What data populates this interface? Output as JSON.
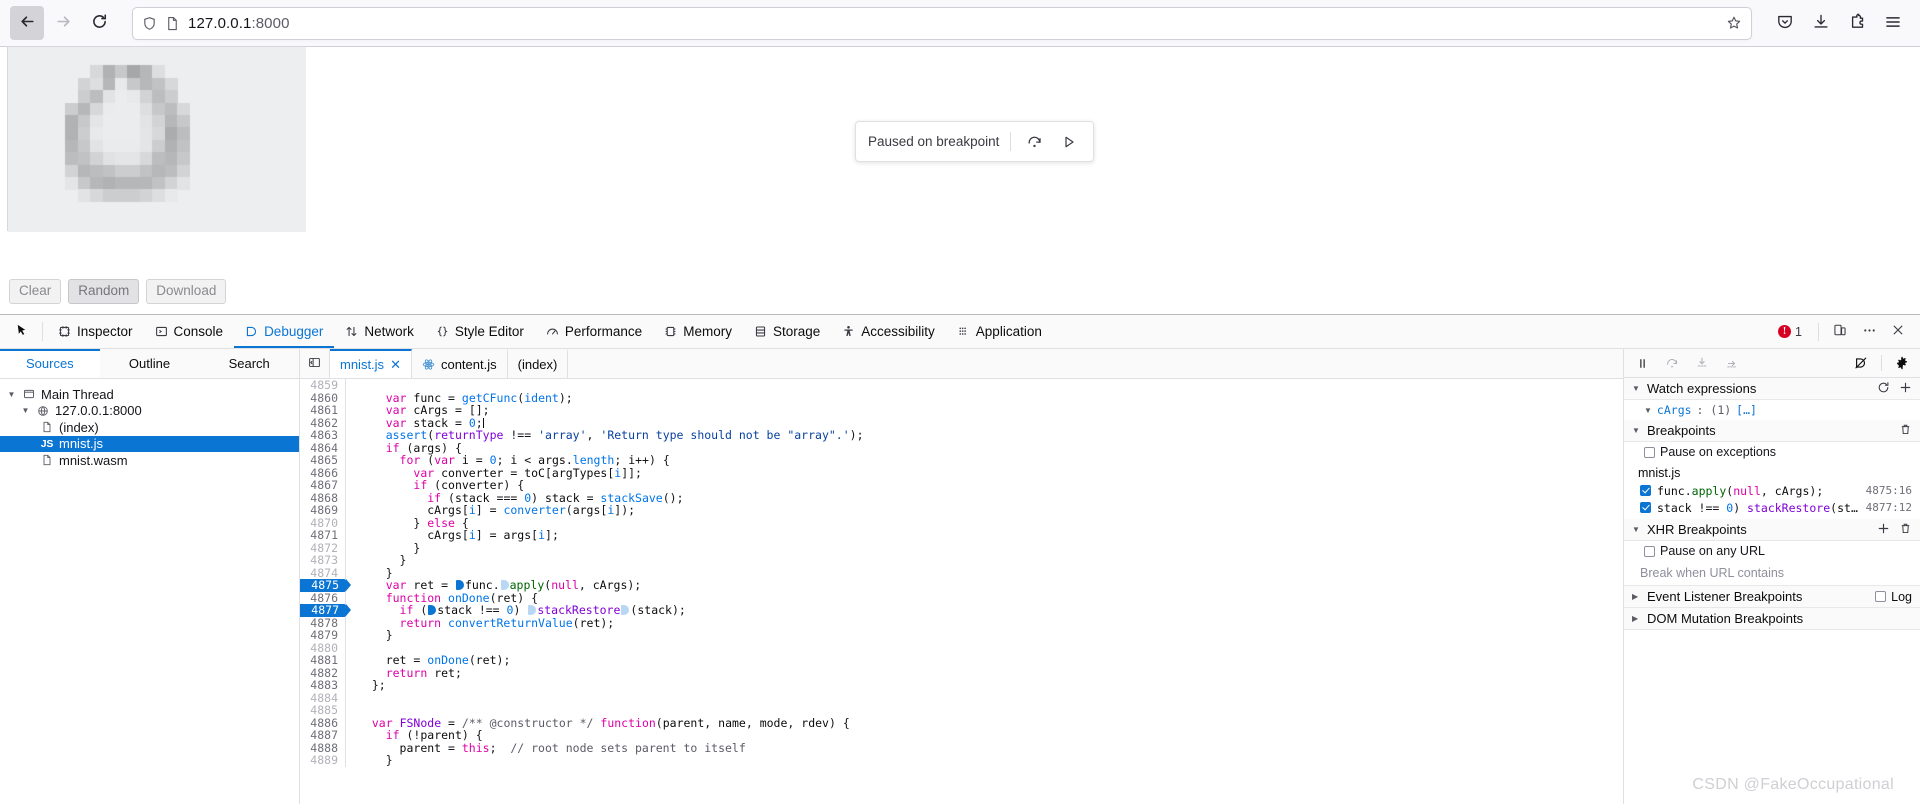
{
  "browser": {
    "nav": {
      "back": "back-arrow",
      "forward": "forward-arrow",
      "reload": "reload-icon"
    },
    "url": {
      "host": "127.0.0.1",
      "port": ":8000",
      "full": "127.0.0.1:8000"
    },
    "right_icons": [
      "pocket-icon",
      "downloads-icon",
      "extensions-icon",
      "menu-icon"
    ]
  },
  "page": {
    "buttons": [
      {
        "label": "Clear",
        "hot": false
      },
      {
        "label": "Random",
        "hot": true
      },
      {
        "label": "Download",
        "hot": false
      }
    ],
    "toast": {
      "text": "Paused on breakpoint",
      "step_icon": "step-over-icon",
      "resume_icon": "resume-play-icon"
    }
  },
  "devtools": {
    "tabs": [
      {
        "label": "Inspector",
        "icon": "inspector-icon",
        "selected": false
      },
      {
        "label": "Console",
        "icon": "console-icon",
        "selected": false
      },
      {
        "label": "Debugger",
        "icon": "debugger-icon",
        "selected": true
      },
      {
        "label": "Network",
        "icon": "network-icon",
        "selected": false
      },
      {
        "label": "Style Editor",
        "icon": "style-editor-icon",
        "selected": false
      },
      {
        "label": "Performance",
        "icon": "performance-icon",
        "selected": false
      },
      {
        "label": "Memory",
        "icon": "memory-icon",
        "selected": false
      },
      {
        "label": "Storage",
        "icon": "storage-icon",
        "selected": false
      },
      {
        "label": "Accessibility",
        "icon": "accessibility-icon",
        "selected": false
      },
      {
        "label": "Application",
        "icon": "application-icon",
        "selected": false
      }
    ],
    "error_count": "1",
    "right_buttons": [
      "responsive-design-icon",
      "meatball-menu-icon",
      "close-icon"
    ]
  },
  "sources": {
    "tabs": [
      {
        "label": "Sources",
        "selected": true
      },
      {
        "label": "Outline",
        "selected": false
      },
      {
        "label": "Search",
        "selected": false
      }
    ],
    "tree": [
      {
        "label": "Main Thread",
        "depth": 0,
        "icon": "thread-icon",
        "twisty": "down",
        "selected": false
      },
      {
        "label": "127.0.0.1:8000",
        "depth": 1,
        "icon": "globe-icon",
        "twisty": "down",
        "selected": false
      },
      {
        "label": "(index)",
        "depth": 2,
        "icon": "document-icon",
        "twisty": "",
        "selected": false
      },
      {
        "label": "mnist.js",
        "depth": 2,
        "icon": "js-badge",
        "twisty": "",
        "selected": true
      },
      {
        "label": "mnist.wasm",
        "depth": 2,
        "icon": "document-icon",
        "twisty": "",
        "selected": false
      }
    ]
  },
  "editor": {
    "tabs": [
      {
        "label": "mnist.js",
        "selected": true,
        "closable": true,
        "icon": ""
      },
      {
        "label": "content.js",
        "selected": false,
        "closable": false,
        "icon": "react-icon"
      },
      {
        "label": "(index)",
        "selected": false,
        "closable": false,
        "icon": ""
      }
    ],
    "lines": [
      {
        "n": "4859",
        "dim": true,
        "bp": false,
        "html": ""
      },
      {
        "n": "4860",
        "dim": false,
        "bp": false,
        "html": "    <span class='k'>var</span> <span class='id'>func</span> = <span class='fn'>getCFunc</span>(<span class='num'>ident</span>);"
      },
      {
        "n": "4861",
        "dim": false,
        "bp": false,
        "html": "    <span class='k'>var</span> <span class='id'>cArgs</span> = [];"
      },
      {
        "n": "4862",
        "dim": false,
        "bp": false,
        "html": "    <span class='k'>var</span> <span class='id'>stack</span> = <span class='num'>0</span>;<span class='caret'></span>"
      },
      {
        "n": "4863",
        "dim": false,
        "bp": false,
        "html": "    <span class='fn'>assert</span>(<span class='pur'>returnType</span> !== <span class='str'>'array'</span>, <span class='str'>'Return type should not be \"array\".'</span>);"
      },
      {
        "n": "4864",
        "dim": false,
        "bp": false,
        "html": "    <span class='k'>if</span> (<span class='id'>args</span>) {"
      },
      {
        "n": "4865",
        "dim": false,
        "bp": false,
        "html": "      <span class='k'>for</span> (<span class='k'>var</span> <span class='id'>i</span> = <span class='num'>0</span>; <span class='id'>i</span> &lt; <span class='id'>args</span>.<span class='fn'>length</span>; <span class='id'>i</span>++) {"
      },
      {
        "n": "4866",
        "dim": false,
        "bp": false,
        "html": "        <span class='k'>var</span> <span class='id'>converter</span> = <span class='id'>toC</span>[<span class='id'>argTypes</span>[<span class='num'>i</span>]];"
      },
      {
        "n": "4867",
        "dim": false,
        "bp": false,
        "html": "        <span class='k'>if</span> (<span class='id'>converter</span>) {"
      },
      {
        "n": "4868",
        "dim": false,
        "bp": false,
        "html": "          <span class='k'>if</span> (<span class='id'>stack</span> === <span class='num'>0</span>) <span class='id'>stack</span> = <span class='fn'>stackSave</span>();"
      },
      {
        "n": "4869",
        "dim": false,
        "bp": false,
        "html": "          <span class='id'>cArgs</span>[<span class='num'>i</span>] = <span class='fn'>converter</span>(<span class='id'>args</span>[<span class='num'>i</span>]);"
      },
      {
        "n": "4870",
        "dim": true,
        "bp": false,
        "html": "        } <span class='k'>else</span> {"
      },
      {
        "n": "4871",
        "dim": false,
        "bp": false,
        "html": "          <span class='id'>cArgs</span>[<span class='num'>i</span>] = <span class='id'>args</span>[<span class='num'>i</span>];"
      },
      {
        "n": "4872",
        "dim": true,
        "bp": false,
        "html": "        }"
      },
      {
        "n": "4873",
        "dim": true,
        "bp": false,
        "html": "      }"
      },
      {
        "n": "4874",
        "dim": true,
        "bp": false,
        "html": "    }"
      },
      {
        "n": "4875",
        "dim": false,
        "bp": true,
        "html": "    <span class='k'>var</span> <span class='id'>ret</span> = <span class='bpdot'></span><span class='id'>func</span>.<span class='bpdot lt'></span><span class='grn'>apply</span>(<span class='k'>null</span>, <span class='id'>cArgs</span>);"
      },
      {
        "n": "4876",
        "dim": false,
        "bp": false,
        "html": "    <span class='k'>function</span> <span class='fn'>onDone</span>(<span class='id'>ret</span>) {"
      },
      {
        "n": "4877",
        "dim": false,
        "bp": true,
        "html": "      <span class='k'>if</span> (<span class='bpdot'></span><span class='id'>stack</span> !== <span class='num'>0</span>) <span class='bpdot lt'></span><span class='pur'>stackRestore</span><span class='bpdot lt'></span>(<span class='id'>stack</span>);"
      },
      {
        "n": "4878",
        "dim": false,
        "bp": false,
        "html": "      <span class='k'>return</span> <span class='fn'>convertReturnValue</span>(<span class='id'>ret</span>);"
      },
      {
        "n": "4879",
        "dim": false,
        "bp": false,
        "html": "    }"
      },
      {
        "n": "4880",
        "dim": true,
        "bp": false,
        "html": ""
      },
      {
        "n": "4881",
        "dim": false,
        "bp": false,
        "html": "    <span class='id'>ret</span> = <span class='fn'>onDone</span>(<span class='id'>ret</span>);"
      },
      {
        "n": "4882",
        "dim": false,
        "bp": false,
        "html": "    <span class='k'>return</span> <span class='id'>ret</span>;"
      },
      {
        "n": "4883",
        "dim": false,
        "bp": false,
        "html": "  };"
      },
      {
        "n": "4884",
        "dim": true,
        "bp": false,
        "html": ""
      },
      {
        "n": "4885",
        "dim": true,
        "bp": false,
        "html": ""
      },
      {
        "n": "4886",
        "dim": false,
        "bp": false,
        "html": "  <span class='k'>var</span> <span class='pur'>FSNode</span> = <span class='cm'>/** @constructor */</span> <span class='k'>function</span>(<span class='id'>parent</span>, <span class='id'>name</span>, <span class='id'>mode</span>, <span class='id'>rdev</span>) {"
      },
      {
        "n": "4887",
        "dim": false,
        "bp": false,
        "html": "    <span class='k'>if</span> (!<span class='id'>parent</span>) {"
      },
      {
        "n": "4888",
        "dim": false,
        "bp": false,
        "html": "      <span class='id'>parent</span> = <span class='k'>this</span>;  <span class='cm'>// root node sets parent to itself</span>"
      },
      {
        "n": "4889",
        "dim": true,
        "bp": false,
        "html": "    }"
      }
    ]
  },
  "right_panel": {
    "toolbar": [
      "pause-icon",
      "step-over-icon",
      "step-in-icon",
      "step-out-icon",
      "deactivate-breakpoints-icon",
      "settings-gear-icon"
    ],
    "watch": {
      "title": "Watch expressions",
      "refresh_icon": "refresh-icon",
      "add_icon": "plus-icon",
      "rows": [
        {
          "name": "cArgs",
          "meta": ": (1)",
          "brackets": "[…]"
        }
      ]
    },
    "breakpoints": {
      "title": "Breakpoints",
      "delete_icon": "trash-icon",
      "pause_on_exceptions": {
        "label": "Pause on exceptions",
        "checked": false
      },
      "file": "mnist.js",
      "items": [
        {
          "code_html": "<span class='id'>func</span>.<span class='grn'>apply</span>(<span class='k'>null</span>, <span class='id'>cArgs</span>);",
          "loc": "4875:16",
          "checked": true
        },
        {
          "code_html": "<span class='id'>stack</span> !== <span class='num'>0</span>) <span class='pur'>stackRestore</span>(<span class='id'>sta…</span>",
          "loc": "4877:12",
          "checked": true
        }
      ]
    },
    "xhr": {
      "title": "XHR Breakpoints",
      "add_icon": "plus-icon",
      "delete_icon": "trash-icon",
      "pause_on_any_url": {
        "label": "Pause on any URL",
        "checked": false
      },
      "input_placeholder": "Break when URL contains"
    },
    "event_listener": {
      "title": "Event Listener Breakpoints",
      "log_label": "Log",
      "log_checked": false
    },
    "dom_mutation": {
      "title": "DOM Mutation Breakpoints"
    }
  },
  "watermark": "CSDN @FakeOccupational",
  "colors": {
    "accent": "#0a75d3",
    "error": "#d70022",
    "chrome_bg": "#f9f9fb"
  }
}
